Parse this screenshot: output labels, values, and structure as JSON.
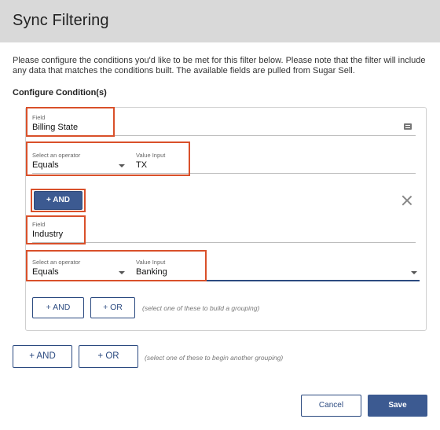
{
  "dialog": {
    "title": "Sync Filtering",
    "description": "Please configure the conditions you'd like to be met for this filter below. Please note that the filter will include any data that matches the conditions built. The available fields are pulled from Sugar Sell.",
    "section_title": "Configure Condition(s)"
  },
  "condition1": {
    "field_label": "Field",
    "field_value": "Billing State",
    "operator_label": "Select an operator",
    "operator_value": "Equals",
    "value_label": "Value Input",
    "value_value": "TX"
  },
  "and_button_label": "+ AND",
  "condition2": {
    "field_label": "Field",
    "field_value": "Industry",
    "operator_label": "Select an operator",
    "operator_value": "Equals",
    "value_label": "Value Input",
    "value_value": "Banking"
  },
  "inner_grouping": {
    "and_label": "+ AND",
    "or_label": "+ OR",
    "hint": "(select one of these to build a grouping)"
  },
  "outer_grouping": {
    "and_label": "+ AND",
    "or_label": "+ OR",
    "hint": "(select one of these to begin another grouping)"
  },
  "footer": {
    "cancel_label": "Cancel",
    "save_label": "Save"
  },
  "colors": {
    "primary": "#3c5a91",
    "highlight": "#d9502a",
    "header_bg": "#d9d9d9"
  }
}
